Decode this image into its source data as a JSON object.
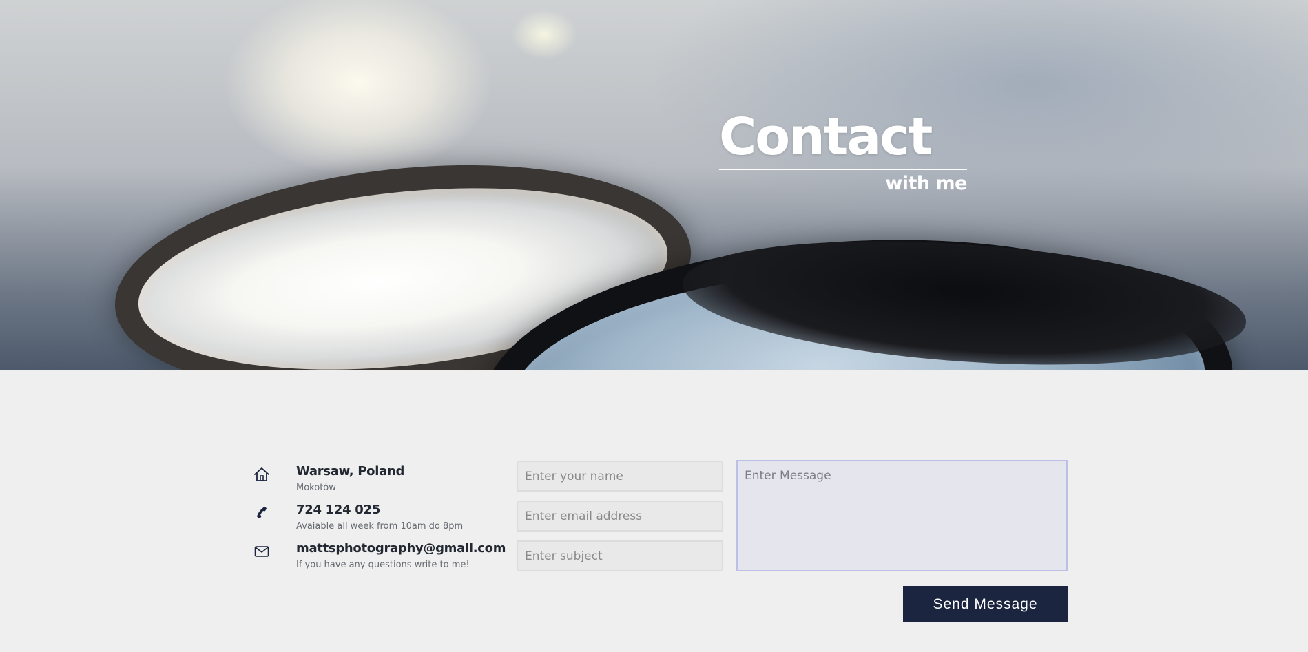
{
  "hero": {
    "title": "Contact",
    "subtitle": "with me"
  },
  "contact_info": [
    {
      "icon": "home-icon",
      "title": "Warsaw, Poland",
      "subtitle": "Mokotów"
    },
    {
      "icon": "phone-icon",
      "title": "724 124 025",
      "subtitle": "Avaiable all week from 10am do 8pm"
    },
    {
      "icon": "mail-icon",
      "title": "mattsphotography@gmail.com",
      "subtitle": "If you have any questions write to me!"
    }
  ],
  "form": {
    "name_placeholder": "Enter your name",
    "email_placeholder": "Enter email address",
    "subject_placeholder": "Enter subject",
    "message_placeholder": "Enter Message",
    "submit_label": "Send Message"
  },
  "colors": {
    "button_bg": "#1b2540",
    "page_bg": "#efefef",
    "message_bg": "#e5e5ee",
    "message_border": "#bcc0e6"
  }
}
